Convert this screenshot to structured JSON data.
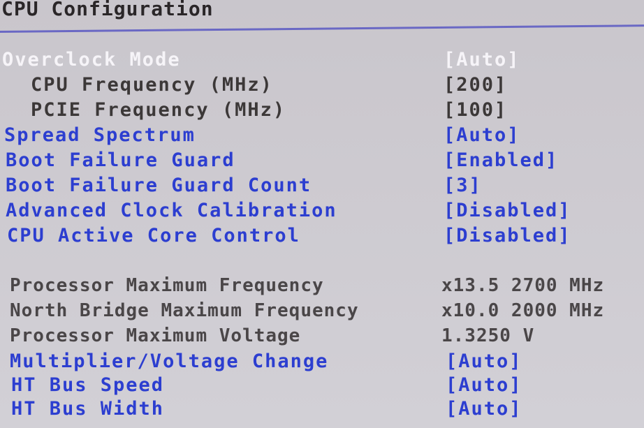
{
  "page": {
    "title": "CPU Configuration"
  },
  "settings": [
    {
      "label": "Overclock Mode",
      "value": "[Auto]",
      "state": "selected"
    },
    {
      "label": "CPU Frequency (MHz)",
      "value": "[200]",
      "state": "sub"
    },
    {
      "label": "PCIE Frequency (MHz)",
      "value": "[100]",
      "state": "sub"
    },
    {
      "label": "Spread Spectrum",
      "value": "[Auto]",
      "state": "editable"
    },
    {
      "label": "Boot Failure Guard",
      "value": "[Enabled]",
      "state": "editable"
    },
    {
      "label": "Boot Failure Guard Count",
      "value": "[3]",
      "state": "editable"
    },
    {
      "label": "Advanced Clock Calibration",
      "value": "[Disabled]",
      "state": "editable"
    },
    {
      "label": "CPU Active Core Control",
      "value": "[Disabled]",
      "state": "editable"
    }
  ],
  "info": [
    {
      "label": "Processor Maximum Frequency",
      "value": "x13.5 2700 MHz"
    },
    {
      "label": "North Bridge Maximum Frequency",
      "value": "x10.0 2000 MHz"
    },
    {
      "label": "Processor Maximum Voltage",
      "value": "1.3250 V"
    }
  ],
  "settings2": [
    {
      "label": "Multiplier/Voltage Change",
      "value": "[Auto]"
    },
    {
      "label": "HT Bus Speed",
      "value": "[Auto]"
    },
    {
      "label": "HT Bus Width",
      "value": "[Auto]"
    }
  ],
  "colors": {
    "selected": "#f6f4f8",
    "editable": "#2c3ed0",
    "info": "#4a4648",
    "divider": "#6a68c4"
  }
}
